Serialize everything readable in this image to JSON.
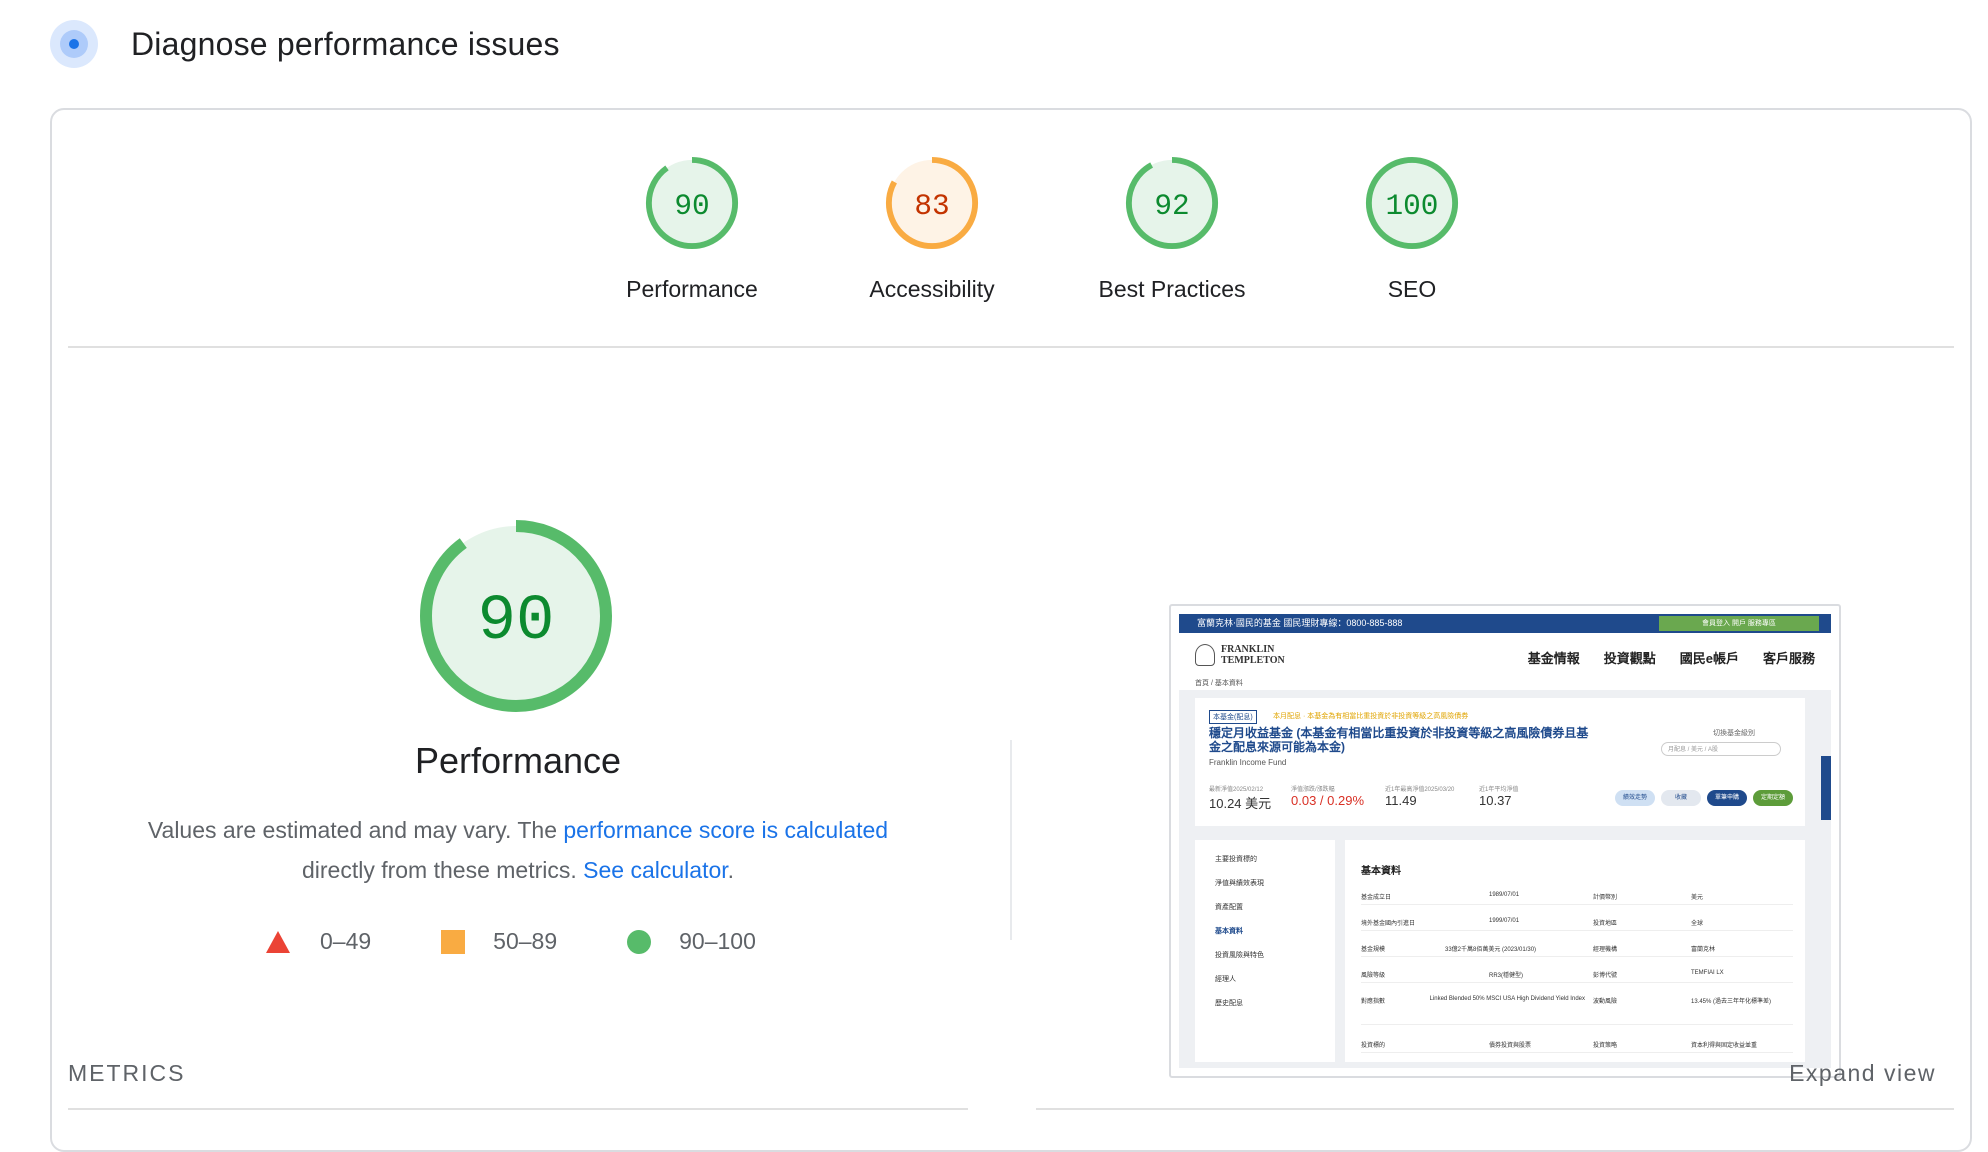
{
  "header": {
    "title": "Diagnose performance issues",
    "icon": "lighthouse-icon"
  },
  "colors": {
    "pass": "#0c8a2f",
    "average": "#c33300",
    "pass_ring": "#57bb6a",
    "average_ring": "#f9ab42",
    "fail": "#eb4335",
    "link": "#1a73e8"
  },
  "gauges": [
    {
      "label": "Performance",
      "score": "90",
      "value": 90,
      "status": "pass"
    },
    {
      "label": "Accessibility",
      "score": "83",
      "value": 83,
      "status": "average"
    },
    {
      "label": "Best Practices",
      "score": "92",
      "value": 92,
      "status": "pass"
    },
    {
      "label": "SEO",
      "score": "100",
      "value": 100,
      "status": "pass"
    }
  ],
  "performance": {
    "score": "90",
    "value": 90,
    "title": "Performance",
    "desc_prefix": "Values are estimated and may vary. The ",
    "link_score": "performance score is calculated",
    "desc_middle": " directly from these metrics. ",
    "link_calculator": "See calculator",
    "desc_suffix": "."
  },
  "legend": [
    {
      "range": "0–49",
      "shape": "triangle"
    },
    {
      "range": "50–89",
      "shape": "square"
    },
    {
      "range": "90–100",
      "shape": "circle"
    }
  ],
  "metrics": {
    "label": "METRICS",
    "expand": "Expand view"
  },
  "screenshot": {
    "top_bar": "富蘭克林‧國民的基金  國民理財專線：0800-885-888",
    "top_links": "會員登入   開戶   服務專區",
    "logo": [
      "FRANKLIN",
      "TEMPLETON"
    ],
    "menu": [
      "基金情報",
      "投資觀點",
      "國民e帳戶",
      "客戶服務"
    ],
    "breadcrumb": "首頁 / 基本資料",
    "tag": "本基金(配息)",
    "tag_note": "本月配息 · 本基金為有相當比重投資於非投資等級之高風險債券",
    "fund_name": "穩定月收益基金 (本基金有相當比重投資於非投資等級之高風險債券且基金之配息來源可能為本金)",
    "fund_en": "Franklin Income Fund",
    "switch_label": "切換基金級別",
    "select_value": "月配息 / 美元 / A股",
    "stats": [
      {
        "label": "最新淨值2025/02/12",
        "value": "10.24 美元"
      },
      {
        "label": "淨值漲跌/漲跌幅",
        "value": "0.03 / 0.29%"
      },
      {
        "label": "近1年最高淨值2025/03/20",
        "value": "11.49"
      },
      {
        "label": "近1年平均淨值",
        "value": "10.37"
      }
    ],
    "buttons": [
      "績效走勢",
      "收藏",
      "單筆申購",
      "定期定額"
    ],
    "sidebar": [
      "主要投資標的",
      "淨值與績效表現",
      "資產配置",
      "基本資料",
      "投資風險與特色",
      "經理人",
      "歷史配息"
    ],
    "main_title": "基本資料",
    "rows": [
      [
        "基金成立日",
        "1989/07/01",
        "計價幣別",
        "美元"
      ],
      [
        "境外基金國內引進日",
        "1999/07/01",
        "投資地區",
        "全球"
      ],
      [
        "基金規模",
        "33億2千萬8佰萬美元 (2023/01/30)",
        "經理機構",
        "富蘭克林"
      ],
      [
        "風險等級",
        "RR3(穩健型)",
        "彭博代號",
        "TEMFIAI LX"
      ],
      [
        "對應指數",
        "Linked Blended 50% MSCI USA High Dividend Yield Index",
        "波動風險",
        "13.45% (過去三年年化標準差)"
      ],
      [
        "投資標的",
        "債券投資與股票",
        "投資策略",
        "資本利得與固定收益並重"
      ]
    ]
  }
}
